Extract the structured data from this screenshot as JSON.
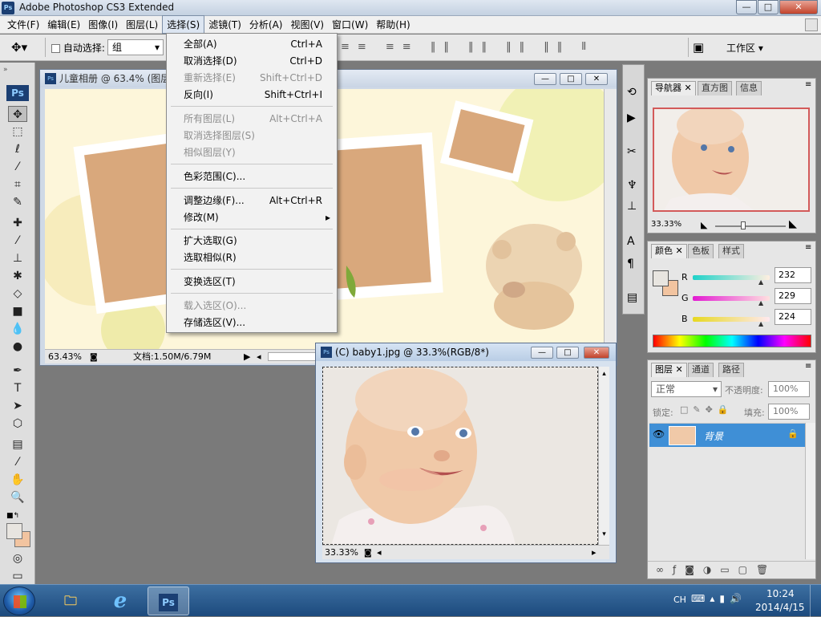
{
  "app": {
    "title": "Adobe Photoshop CS3 Extended",
    "logo": "Ps"
  },
  "window_controls": {
    "minimize": "—",
    "maximize": "□",
    "close": "✕"
  },
  "menubar": [
    {
      "label": "文件(F)"
    },
    {
      "label": "编辑(E)"
    },
    {
      "label": "图像(I)"
    },
    {
      "label": "图层(L)"
    },
    {
      "label": "选择(S)"
    },
    {
      "label": "滤镜(T)"
    },
    {
      "label": "分析(A)"
    },
    {
      "label": "视图(V)"
    },
    {
      "label": "窗口(W)"
    },
    {
      "label": "帮助(H)"
    }
  ],
  "options_bar": {
    "auto_select_label": "自动选择:",
    "auto_select_value": "组",
    "workspace_label": "工作区"
  },
  "select_menu": {
    "items": [
      {
        "label": "全部(A)",
        "shortcut": "Ctrl+A",
        "enabled": true
      },
      {
        "label": "取消选择(D)",
        "shortcut": "Ctrl+D",
        "enabled": true
      },
      {
        "label": "重新选择(E)",
        "shortcut": "Shift+Ctrl+D",
        "enabled": false
      },
      {
        "label": "反向(I)",
        "shortcut": "Shift+Ctrl+I",
        "enabled": true
      },
      {
        "label": "所有图层(L)",
        "shortcut": "Alt+Ctrl+A",
        "enabled": false
      },
      {
        "label": "取消选择图层(S)",
        "shortcut": "",
        "enabled": false
      },
      {
        "label": "相似图层(Y)",
        "shortcut": "",
        "enabled": false
      },
      {
        "label": "色彩范围(C)...",
        "shortcut": "",
        "enabled": true
      },
      {
        "label": "调整边缘(F)...",
        "shortcut": "Alt+Ctrl+R",
        "enabled": true
      },
      {
        "label": "修改(M)",
        "shortcut": "▸",
        "enabled": true
      },
      {
        "label": "扩大选取(G)",
        "shortcut": "",
        "enabled": true
      },
      {
        "label": "选取相似(R)",
        "shortcut": "",
        "enabled": true
      },
      {
        "label": "变换选区(T)",
        "shortcut": "",
        "enabled": true
      },
      {
        "label": "载入选区(O)...",
        "shortcut": "",
        "enabled": false
      },
      {
        "label": "存储选区(V)...",
        "shortcut": "",
        "enabled": true
      }
    ]
  },
  "doc1": {
    "title": "儿童相册 @ 63.4% (图层",
    "zoom": "63.43%",
    "docsize": "文档:1.50M/6.79M"
  },
  "doc2": {
    "title": "(C) baby1.jpg @ 33.3%(RGB/8*)",
    "zoom": "33.33%"
  },
  "navigator": {
    "tabs": [
      "导航器",
      "直方图",
      "信息"
    ],
    "zoom": "33.33%"
  },
  "color_panel": {
    "tabs": [
      "颜色",
      "色板",
      "样式"
    ],
    "channels": [
      {
        "name": "R",
        "value": "232"
      },
      {
        "name": "G",
        "value": "229"
      },
      {
        "name": "B",
        "value": "224"
      }
    ]
  },
  "layers_panel": {
    "tabs": [
      "图层",
      "通道",
      "路径"
    ],
    "blend_mode": "正常",
    "opacity_label": "不透明度:",
    "opacity": "100%",
    "lock_label": "锁定:",
    "fill_label": "填充:",
    "fill": "100%",
    "layer_name": "背景"
  },
  "taskbar": {
    "lang": "CH",
    "time": "10:24",
    "date": "2014/4/15"
  },
  "colors": {
    "accent_highlight": "#3f8fd6",
    "close_red": "#c2432b",
    "ps_blue": "#1b3f73"
  }
}
